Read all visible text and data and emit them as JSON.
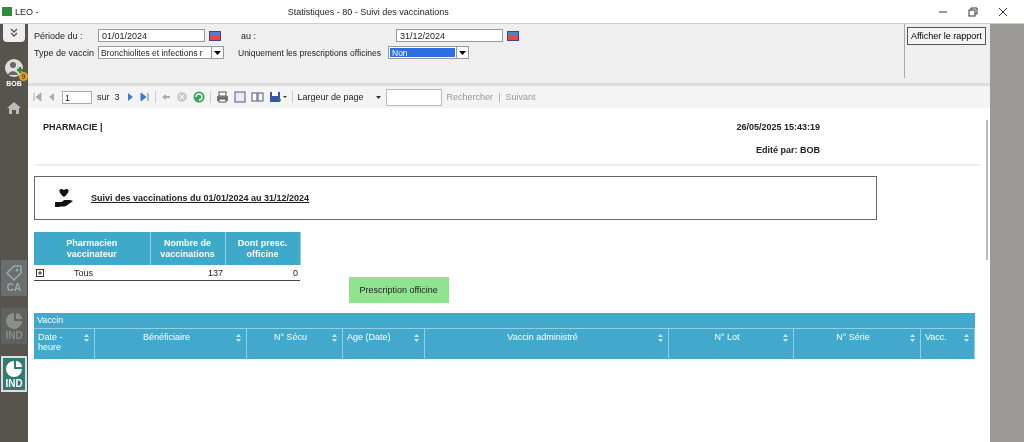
{
  "window": {
    "app": "LEO -",
    "title": "Statistiques - 80 - Suivi des vaccinations"
  },
  "sidebar": {
    "user": {
      "name": "BOB",
      "badge": "9"
    },
    "modules": [
      {
        "label": "CA",
        "selected": false,
        "disabled": false
      },
      {
        "label": "IND",
        "selected": false,
        "disabled": true
      },
      {
        "label": "IND",
        "selected": true,
        "disabled": false
      }
    ]
  },
  "params": {
    "from_label": "Période du :",
    "from": "01/01/2024",
    "to_label": "au :",
    "to": "31/12/2024",
    "type_label": "Type de vaccin",
    "type": "Bronchiolites et infections r",
    "only_label": "Uniquement les prescriptions officines",
    "only": "Non",
    "run_button": "Afficher le rapport"
  },
  "toolbar": {
    "page": "1",
    "of_label": "sur",
    "pages": "3",
    "zoom": "Largeur de page",
    "search_button": "Rechercher",
    "separator": "|",
    "next_button": "Suivant"
  },
  "report": {
    "pharmacy": "PHARMACIE |",
    "printed": "26/05/2025 15:43:19",
    "editor": "Edité par: BOB",
    "title": "Suivi des vaccinations du 01/01/2024 au 31/12/2024",
    "summary": {
      "columns": [
        "Pharmacien vaccinateur",
        "Nombre de vaccinations",
        "Dont presc. officine"
      ],
      "rows": [
        {
          "expanded": false,
          "cells": [
            "Tous",
            "137",
            "0"
          ]
        }
      ]
    },
    "legend": "Prescription officine",
    "table": {
      "caption": "Vaccin",
      "columns": [
        "Date - heure",
        "Bénéficiaire",
        "N° Sécu",
        "Age (Date)",
        "Vaccin administré",
        "N° Lot",
        "N° Série",
        "Vacc."
      ]
    }
  }
}
